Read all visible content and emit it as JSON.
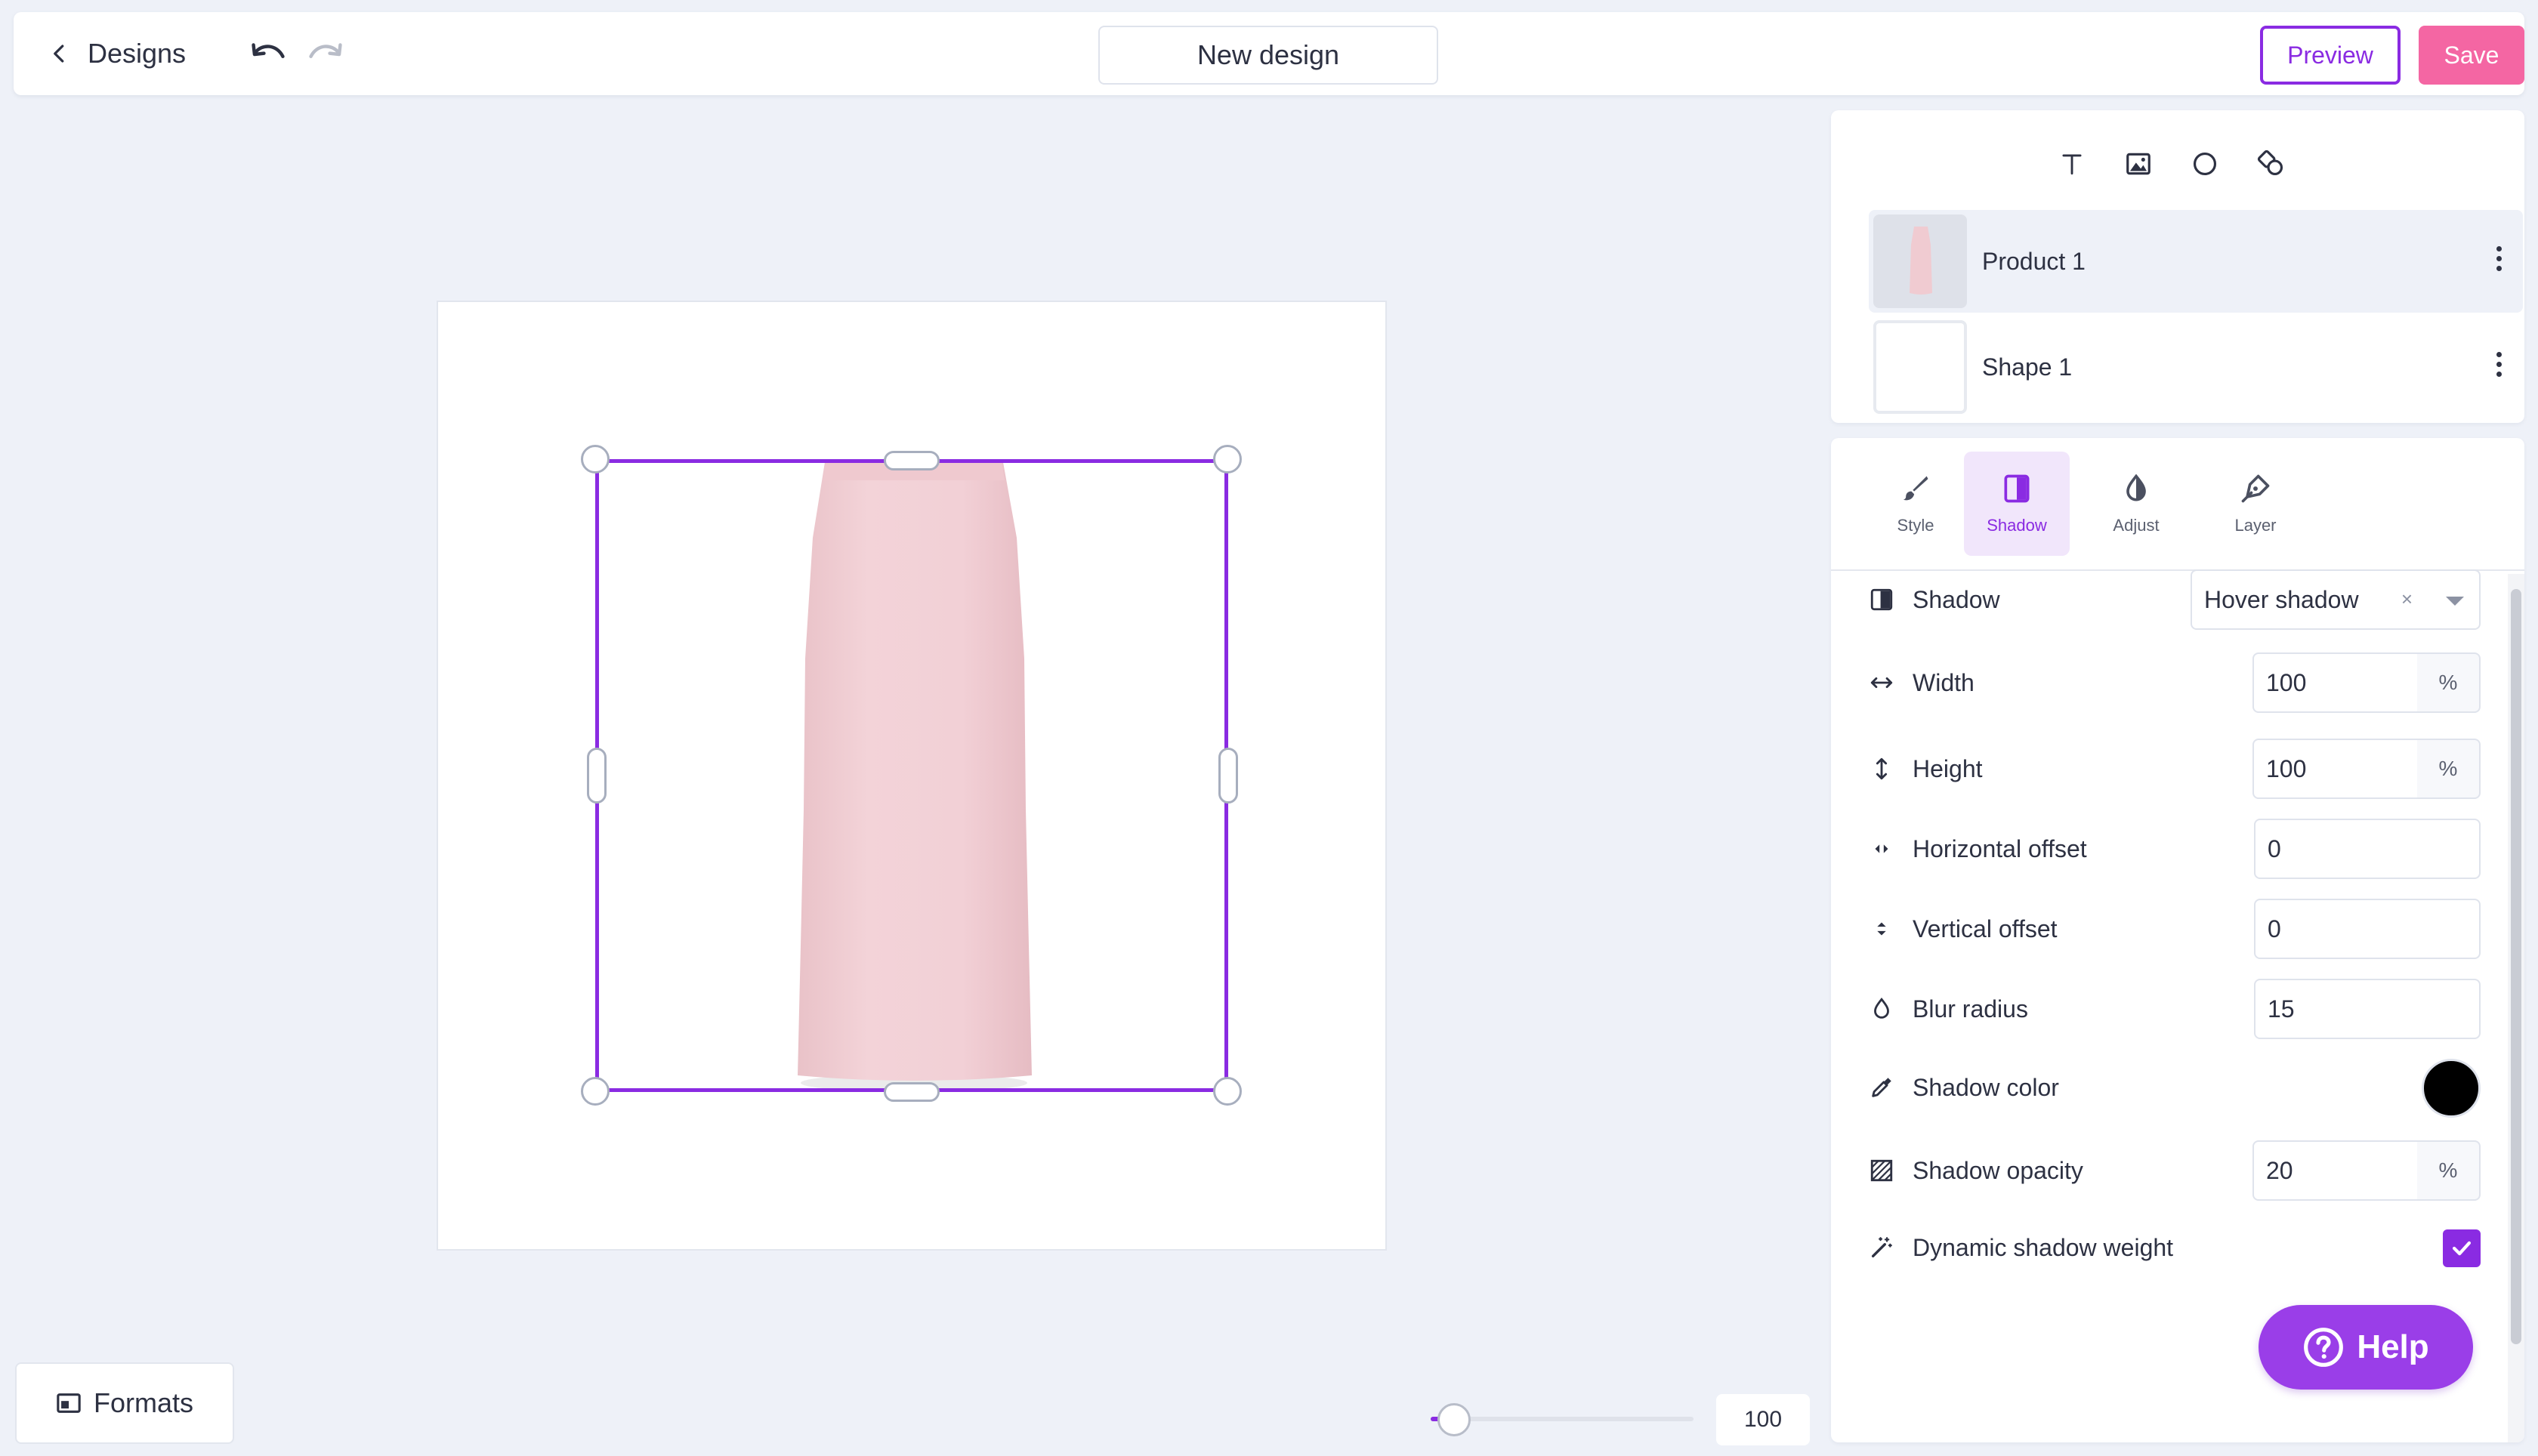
{
  "header": {
    "back_label": "Designs",
    "design_title": "New design",
    "preview_label": "Preview",
    "save_label": "Save"
  },
  "colors": {
    "accent": "#8a2be2",
    "save": "#f466a3",
    "shadow_color": "#000000",
    "product": "#f1cfd5"
  },
  "insert_tools": [
    "text-icon",
    "image-icon",
    "circle-icon",
    "shapes-icon"
  ],
  "layers": [
    {
      "name": "Product 1",
      "active": true
    },
    {
      "name": "Shape 1",
      "active": false
    }
  ],
  "tabs": [
    {
      "label": "Style",
      "icon": "brush-icon"
    },
    {
      "label": "Shadow",
      "icon": "shadow-icon",
      "active": true
    },
    {
      "label": "Adjust",
      "icon": "contrast-icon"
    },
    {
      "label": "Layer",
      "icon": "pen-icon"
    }
  ],
  "shadow": {
    "shadow_label": "Shadow",
    "shadow_value": "Hover shadow",
    "clear_symbol": "×",
    "width_label": "Width",
    "width_value": "100",
    "height_label": "Height",
    "height_value": "100",
    "hoffset_label": "Horizontal offset",
    "hoffset_value": "0",
    "voffset_label": "Vertical offset",
    "voffset_value": "0",
    "blur_label": "Blur radius",
    "blur_value": "15",
    "color_label": "Shadow color",
    "opacity_label": "Shadow opacity",
    "opacity_value": "20",
    "dynamic_label": "Dynamic shadow weight",
    "dynamic_checked": true,
    "percent_unit": "%"
  },
  "help_label": "Help",
  "formats_label": "Formats",
  "zoom": {
    "value": "100",
    "fraction": 0.09
  }
}
